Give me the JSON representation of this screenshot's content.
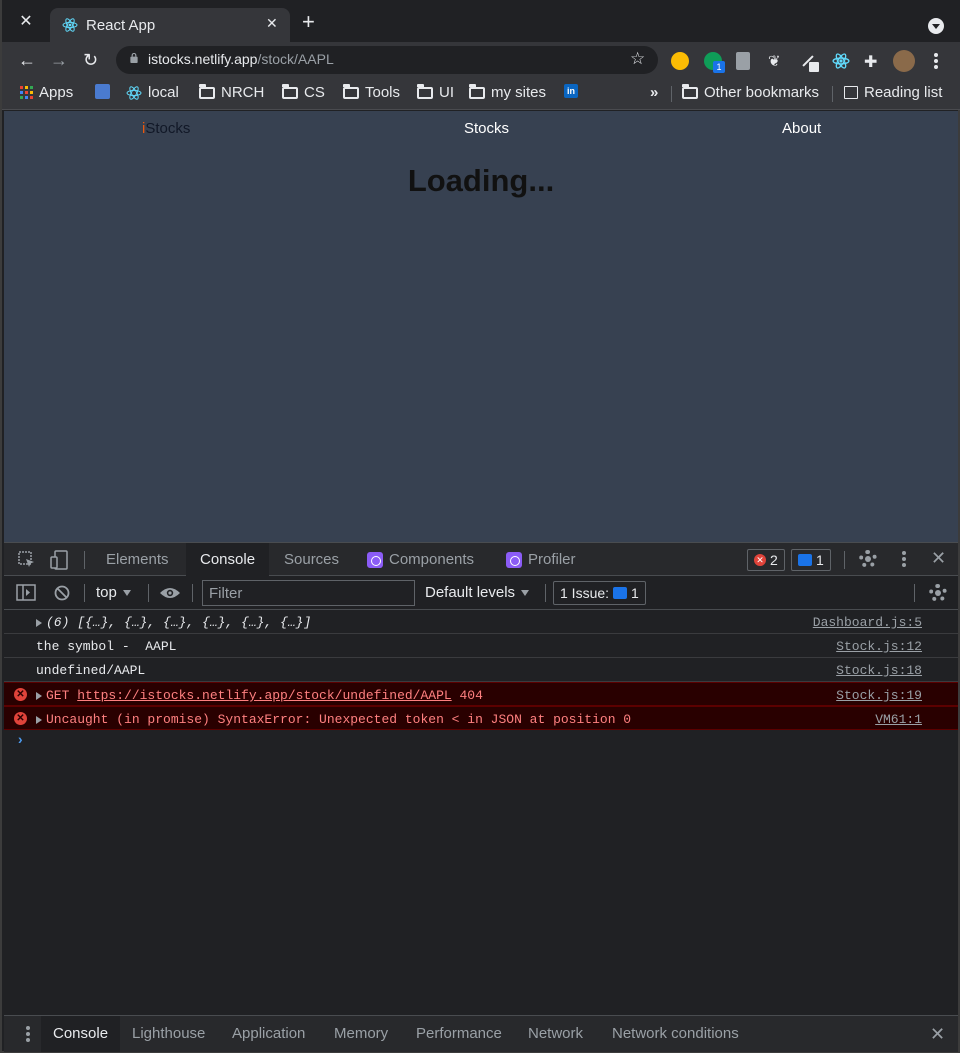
{
  "browser": {
    "tab_title": "React App",
    "url_host": "istocks.netlify.app",
    "url_path": "/stock/AAPL",
    "bookmarks": [
      "Apps",
      "local",
      "NRCH",
      "CS",
      "Tools",
      "UI",
      "my sites"
    ],
    "other_bookmarks": "Other bookmarks",
    "reading_list": "Reading list",
    "ext_badge": "1",
    "more": "»"
  },
  "page": {
    "brand_first": "i",
    "brand_rest": "Stocks",
    "nav_stocks": "Stocks",
    "nav_about": "About",
    "loading": "Loading..."
  },
  "devtools": {
    "tabs": [
      "Elements",
      "Console",
      "Sources",
      "Components",
      "Profiler"
    ],
    "error_count": "2",
    "message_count": "1",
    "context": "top",
    "filter_placeholder": "Filter",
    "levels": "Default levels",
    "issues_label": "1 Issue:",
    "issues_count": "1",
    "console_rows": [
      {
        "type": "log",
        "text": "(6) [{…}, {…}, {…}, {…}, {…}, {…}]",
        "source": "Dashboard.js:5"
      },
      {
        "type": "log",
        "text": "the symbol -  AAPL",
        "source": "Stock.js:12"
      },
      {
        "type": "log",
        "text": "undefined/AAPL",
        "source": "Stock.js:18"
      },
      {
        "type": "error",
        "method": "GET",
        "url": "https://istocks.netlify.app/stock/undefined/AAPL",
        "status": "404",
        "source": "Stock.js:19"
      },
      {
        "type": "error",
        "text": "Uncaught (in promise) SyntaxError: Unexpected token < in JSON at position 0",
        "source": "VM61:1"
      }
    ],
    "prompt": "›",
    "drawer_tabs": [
      "Console",
      "Lighthouse",
      "Application",
      "Memory",
      "Performance",
      "Network",
      "Network conditions"
    ]
  },
  "colors": {
    "page_bg": "#374151",
    "brand_accent": "#ea580c",
    "error_bg": "#290000",
    "error_text": "#ff8080",
    "react_badge": "#8b5cf6"
  }
}
